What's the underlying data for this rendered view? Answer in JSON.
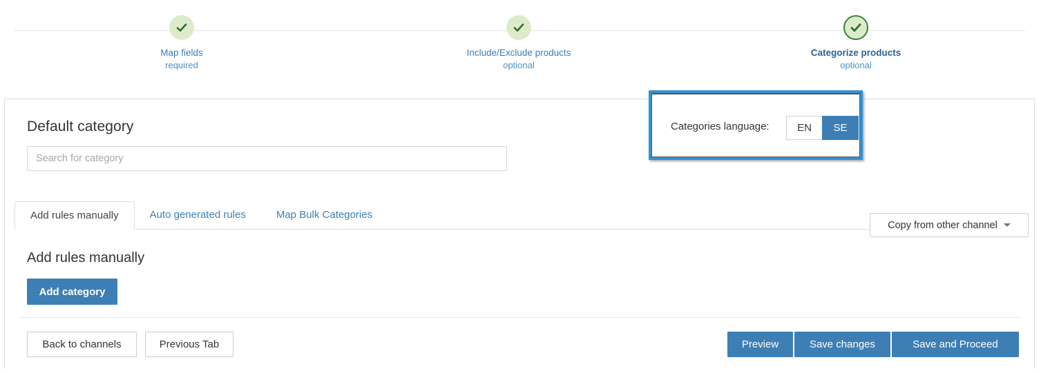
{
  "stepper": {
    "steps": [
      {
        "label": "Map fields",
        "sub": "required",
        "state": "complete",
        "icon": "check-icon"
      },
      {
        "label": "Include/Exclude products",
        "sub": "optional",
        "state": "complete",
        "icon": "check-icon"
      },
      {
        "label": "Categorize products",
        "sub": "optional",
        "state": "active",
        "icon": "check-icon"
      }
    ]
  },
  "main": {
    "default_category_title": "Default category",
    "search": {
      "placeholder": "Search for category",
      "value": ""
    },
    "language": {
      "label": "Categories language:",
      "options": [
        "EN",
        "SE"
      ],
      "selected": "SE",
      "highlight_color": "#3191d4"
    },
    "copy_dropdown": {
      "label": "Copy from other channel",
      "caret": "chevron-down-icon"
    },
    "tabs": [
      {
        "label": "Add rules manually",
        "active": true
      },
      {
        "label": "Auto generated rules",
        "active": false
      },
      {
        "label": "Map Bulk Categories",
        "active": false
      }
    ],
    "manual_heading": "Add rules manually",
    "add_category_button": "Add category"
  },
  "footer": {
    "back_to_channels": "Back to channels",
    "previous_tab": "Previous Tab",
    "preview": "Preview",
    "save_changes": "Save changes",
    "save_and_proceed": "Save and Proceed"
  },
  "colors": {
    "accent_blue": "#3d7fb5",
    "link_blue": "#3b7fb5",
    "step_green_fill": "#dceccb",
    "step_green_stroke": "#3d7d3d",
    "highlight_blue": "#3191d4"
  }
}
